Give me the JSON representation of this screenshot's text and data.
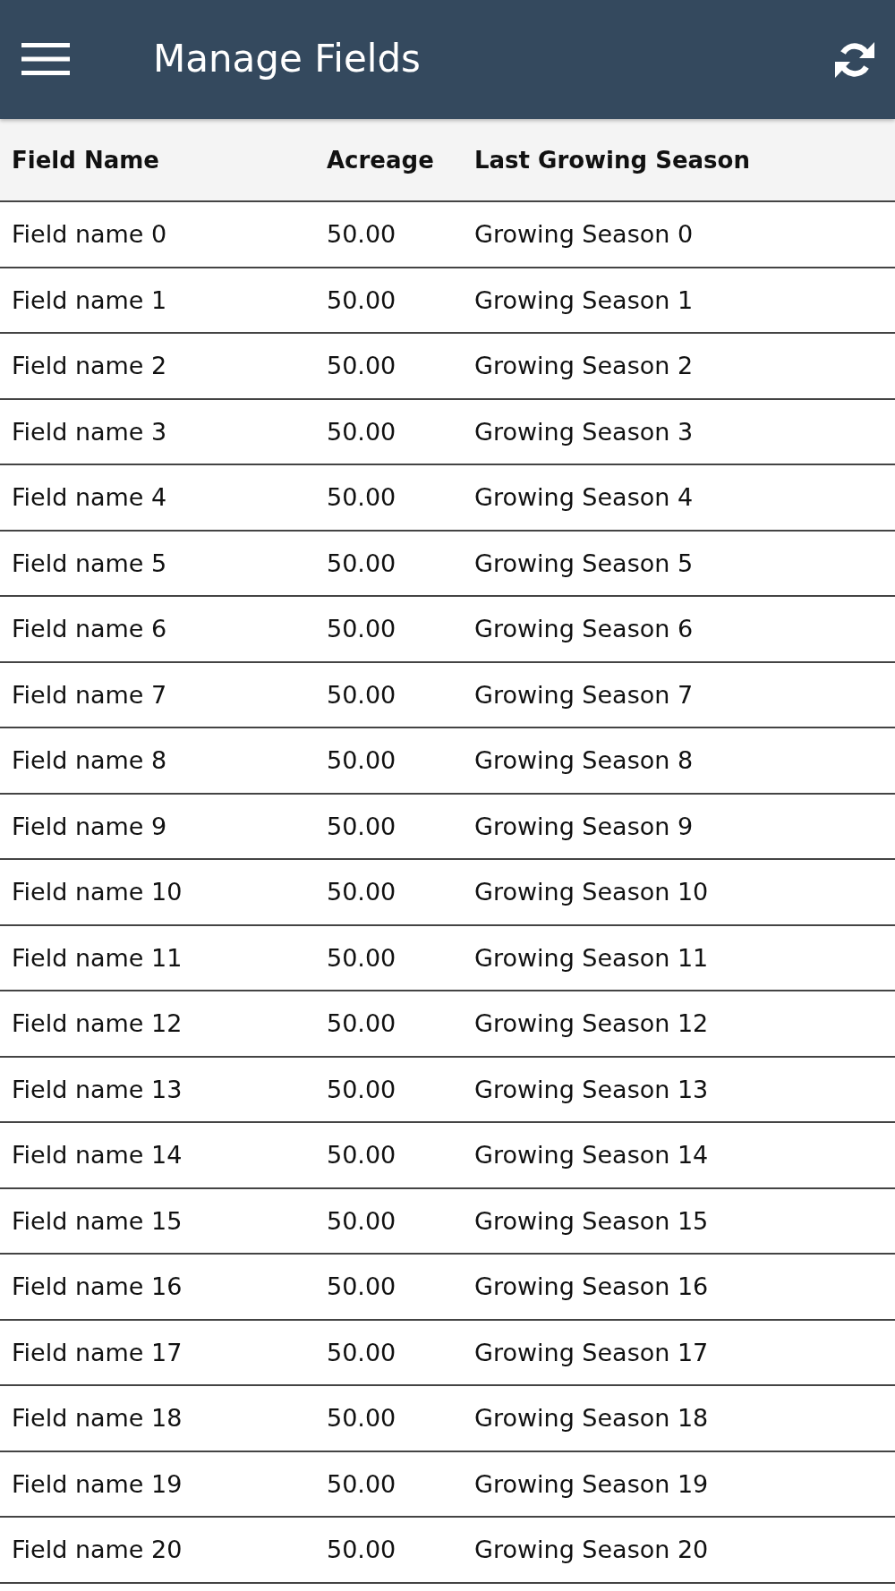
{
  "app_bar": {
    "title": "Manage Fields"
  },
  "table": {
    "columns": [
      "Field Name",
      "Acreage",
      "Last Growing Season"
    ],
    "rows": [
      [
        "Field name 0",
        "50.00",
        "Growing Season 0"
      ],
      [
        "Field name 1",
        "50.00",
        "Growing Season 1"
      ],
      [
        "Field name 2",
        "50.00",
        "Growing Season 2"
      ],
      [
        "Field name 3",
        "50.00",
        "Growing Season 3"
      ],
      [
        "Field name 4",
        "50.00",
        "Growing Season 4"
      ],
      [
        "Field name 5",
        "50.00",
        "Growing Season 5"
      ],
      [
        "Field name 6",
        "50.00",
        "Growing Season 6"
      ],
      [
        "Field name 7",
        "50.00",
        "Growing Season 7"
      ],
      [
        "Field name 8",
        "50.00",
        "Growing Season 8"
      ],
      [
        "Field name 9",
        "50.00",
        "Growing Season 9"
      ],
      [
        "Field name 10",
        "50.00",
        "Growing Season 10"
      ],
      [
        "Field name 11",
        "50.00",
        "Growing Season 11"
      ],
      [
        "Field name 12",
        "50.00",
        "Growing Season 12"
      ],
      [
        "Field name 13",
        "50.00",
        "Growing Season 13"
      ],
      [
        "Field name 14",
        "50.00",
        "Growing Season 14"
      ],
      [
        "Field name 15",
        "50.00",
        "Growing Season 15"
      ],
      [
        "Field name 16",
        "50.00",
        "Growing Season 16"
      ],
      [
        "Field name 17",
        "50.00",
        "Growing Season 17"
      ],
      [
        "Field name 18",
        "50.00",
        "Growing Season 18"
      ],
      [
        "Field name 19",
        "50.00",
        "Growing Season 19"
      ],
      [
        "Field name 20",
        "50.00",
        "Growing Season 20"
      ]
    ]
  }
}
